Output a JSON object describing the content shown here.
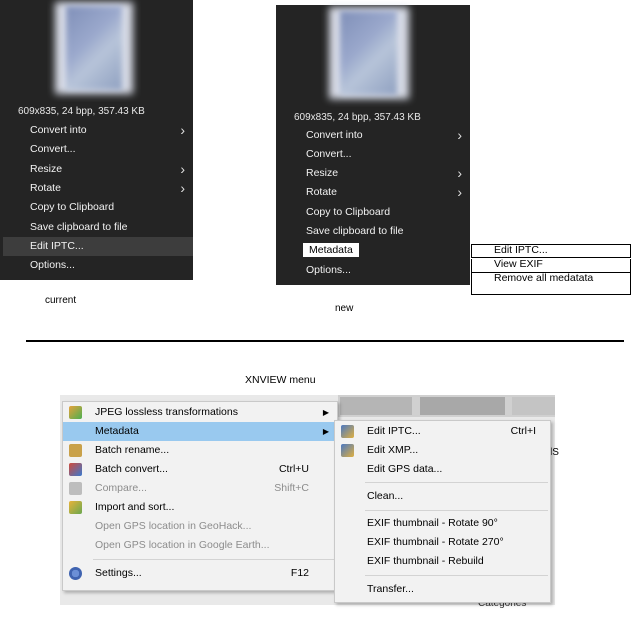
{
  "current_menu": {
    "info": "609x835, 24 bpp, 357.43 KB",
    "items": [
      {
        "label": "Convert into",
        "submenu": true
      },
      {
        "label": "Convert...",
        "submenu": false
      },
      {
        "label": "Resize",
        "submenu": true
      },
      {
        "label": "Rotate",
        "submenu": true
      },
      {
        "label": "Copy to Clipboard",
        "submenu": false
      },
      {
        "label": "Save clipboard to file",
        "submenu": false
      },
      {
        "label": "Edit IPTC...",
        "submenu": false
      },
      {
        "label": "Options...",
        "submenu": false
      }
    ],
    "caption": "current"
  },
  "new_menu": {
    "info": "609x835, 24 bpp, 357.43 KB",
    "items": [
      {
        "label": "Convert into",
        "submenu": true
      },
      {
        "label": "Convert...",
        "submenu": false
      },
      {
        "label": "Resize",
        "submenu": true
      },
      {
        "label": "Rotate",
        "submenu": true
      },
      {
        "label": "Copy to Clipboard",
        "submenu": false
      },
      {
        "label": "Save clipboard to file",
        "submenu": false
      },
      {
        "label": "Metadata",
        "submenu": false
      },
      {
        "label": "Options...",
        "submenu": false
      }
    ],
    "submenu": [
      "Edit IPTC...",
      "View EXIF",
      "Remove all medatata"
    ],
    "caption": "new"
  },
  "xnview": {
    "title": "XNVIEW menu",
    "main_items": [
      {
        "label": "JPEG lossless transformations",
        "shortcut": "",
        "arrow": true
      },
      {
        "label": "Metadata",
        "shortcut": "",
        "arrow": true
      },
      {
        "label": "Batch rename...",
        "shortcut": ""
      },
      {
        "label": "Batch convert...",
        "shortcut": "Ctrl+U"
      },
      {
        "label": "Compare...",
        "shortcut": "Shift+C"
      },
      {
        "label": "Import and sort...",
        "shortcut": ""
      },
      {
        "label": "Open GPS location in GeoHack...",
        "shortcut": ""
      },
      {
        "label": "Open GPS location in Google Earth...",
        "shortcut": ""
      },
      {
        "label": "Settings...",
        "shortcut": "F12"
      }
    ],
    "sub_items": [
      {
        "label": "Edit IPTC...",
        "shortcut": "Ctrl+I"
      },
      {
        "label": "Edit XMP...",
        "shortcut": ""
      },
      {
        "label": "Edit GPS data...",
        "shortcut": ""
      },
      {
        "label": "Clean...",
        "shortcut": ""
      },
      {
        "label": "EXIF thumbnail - Rotate 90°",
        "shortcut": ""
      },
      {
        "label": "EXIF thumbnail - Rotate 270°",
        "shortcut": ""
      },
      {
        "label": "EXIF thumbnail - Rebuild",
        "shortcut": ""
      },
      {
        "label": "Transfer...",
        "shortcut": ""
      }
    ],
    "background_fragments": [
      "lS",
      "Categories"
    ]
  }
}
